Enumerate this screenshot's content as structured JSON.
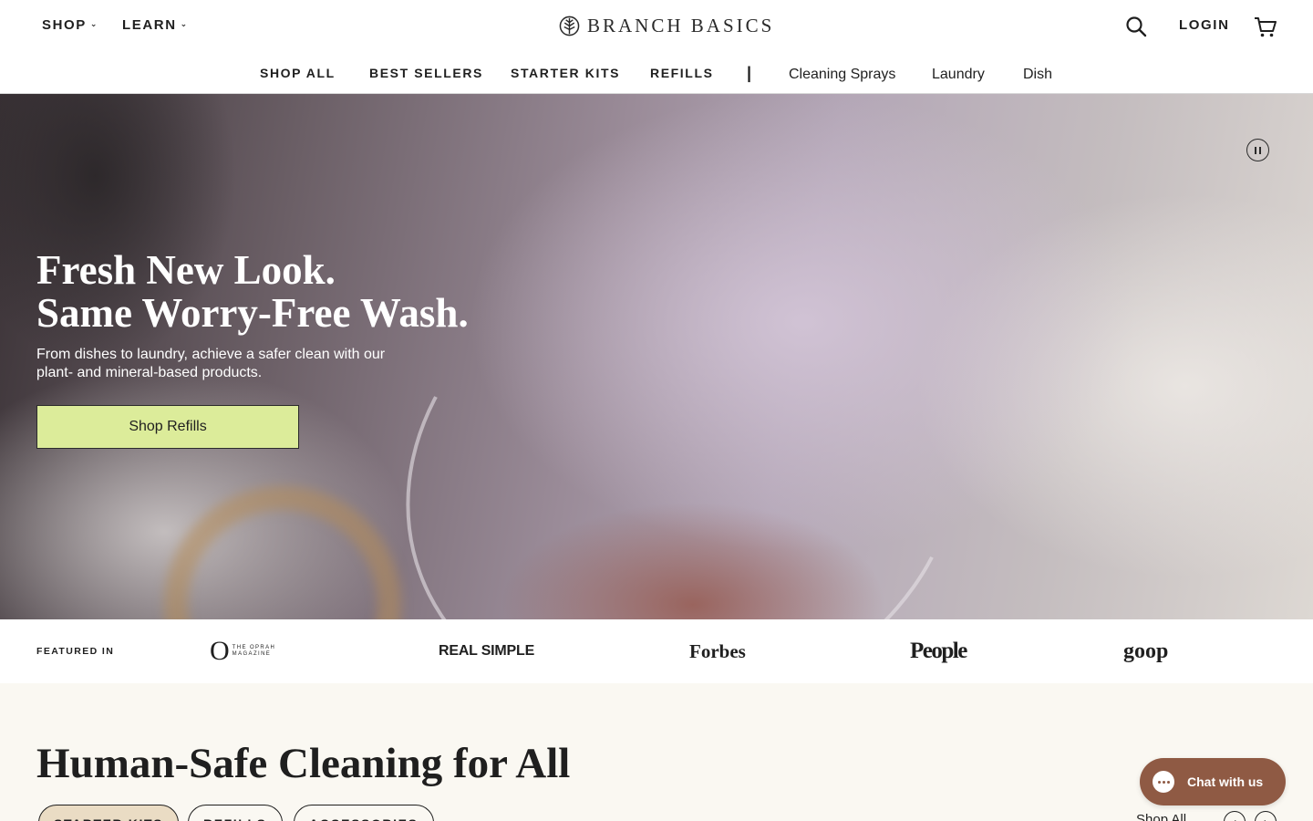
{
  "header": {
    "shop_label": "SHOP",
    "learn_label": "LEARN",
    "brand_name": "BRANCH BASICS",
    "login_label": "LOGIN"
  },
  "subnav": {
    "items": [
      "SHOP ALL",
      "BEST SELLERS",
      "STARTER KITS",
      "REFILLS"
    ],
    "separator": "|",
    "categories": [
      "Cleaning Sprays",
      "Laundry",
      "Dish"
    ]
  },
  "hero": {
    "title_line1": "Fresh New Look.",
    "title_line2": "Same Worry-Free Wash.",
    "subtitle": "From dishes to laundry, achieve a safer clean with our plant- and mineral-based products.",
    "cta_label": "Shop Refills"
  },
  "featured": {
    "label": "FEATURED IN",
    "logos": {
      "oprah_o": "O",
      "oprah_small_1": "THE OPRAH",
      "oprah_small_2": "MAGAZINE",
      "realsimple": "REAL SIMPLE",
      "forbes": "Forbes",
      "people": "People",
      "goop": "goop"
    }
  },
  "section": {
    "title": "Human-Safe Cleaning for All",
    "tabs": [
      "STARTER KITS",
      "REFILLS",
      "ACCESSORIES"
    ],
    "show_all": "Shop All",
    "prev_arrow": "‹",
    "next_arrow": "›"
  },
  "chat": {
    "label": "Chat with us"
  },
  "colors": {
    "cta_background": "#dcec9a",
    "chat_background": "#8f5a44",
    "active_tab": "#eadcc4",
    "section_background": "#faf8f2"
  }
}
